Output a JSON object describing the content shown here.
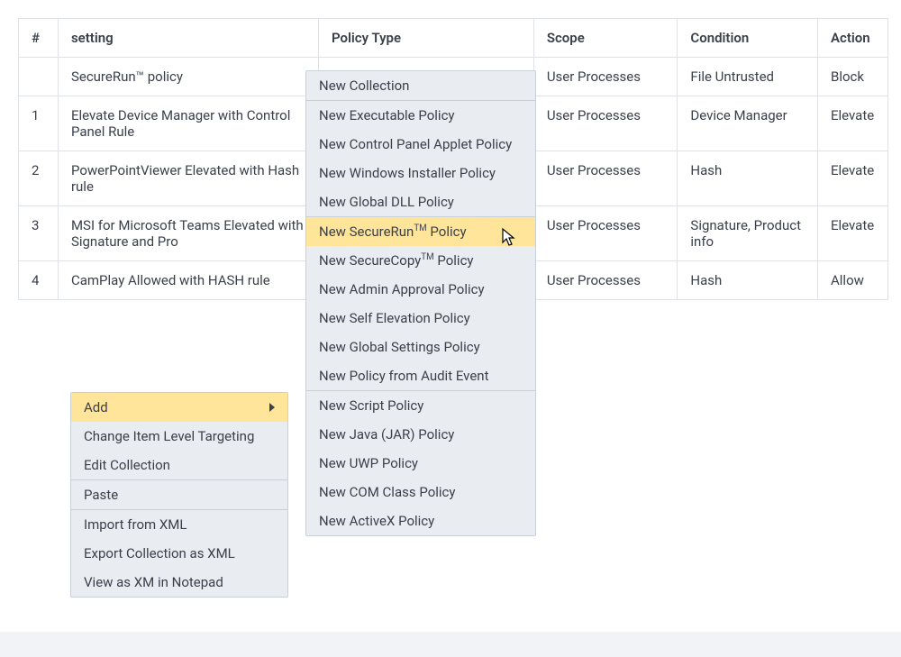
{
  "table": {
    "headers": {
      "num": "#",
      "setting": "setting",
      "policy_type": "Policy Type",
      "scope": "Scope",
      "condition": "Condition",
      "action": "Action"
    },
    "rows": [
      {
        "num": "",
        "setting": "SecureRun™ policy",
        "policy_type": "",
        "scope": "User Processes",
        "condition": "File Untrusted",
        "action": "Block"
      },
      {
        "num": "1",
        "setting": "Elevate Device Manager with Control Panel Rule",
        "policy_type": "",
        "scope": "User Processes",
        "condition": "Device Manager",
        "action": "Elevate"
      },
      {
        "num": "2",
        "setting": "PowerPointViewer Elevated with Hash rule",
        "policy_type": "",
        "scope": "User Processes",
        "condition": "Hash",
        "action": "Elevate"
      },
      {
        "num": "3",
        "setting": "MSI for Microsoft Teams Elevated with Signature and Pro",
        "policy_type": "",
        "scope": "User Processes",
        "condition": "Signature, Product info",
        "action": "Elevate"
      },
      {
        "num": "4",
        "setting": "CamPlay Allowed with HASH rule",
        "policy_type": "",
        "scope": "User Processes",
        "condition": "Hash",
        "action": "Allow"
      }
    ]
  },
  "context_menu": {
    "items": [
      {
        "label": "Add",
        "has_sub": true,
        "highlight": true
      },
      {
        "label": "Change Item Level Targeting"
      },
      {
        "label": "Edit Collection"
      },
      {
        "sep": true
      },
      {
        "label": "Paste"
      },
      {
        "sep": true
      },
      {
        "label": "Import from XML"
      },
      {
        "label": "Export Collection as XML"
      },
      {
        "label": "View as XM in Notepad"
      }
    ]
  },
  "sub_menu": {
    "items": [
      {
        "label": "New Collection"
      },
      {
        "sep": true
      },
      {
        "label": "New Executable Policy"
      },
      {
        "label": "New Control Panel Applet Policy"
      },
      {
        "label": "New Windows Installer Policy"
      },
      {
        "label": "New Global DLL Policy"
      },
      {
        "sep": true
      },
      {
        "label_pre": "New SecureRun",
        "label_sup": "TM",
        "label_post": " Policy",
        "highlight": true
      },
      {
        "label_pre": "New SecureCopy",
        "label_sup": "TM",
        "label_post": " Policy"
      },
      {
        "label": "New Admin Approval Policy"
      },
      {
        "label": "New Self Elevation Policy"
      },
      {
        "label": "New Global Settings Policy"
      },
      {
        "label": "New Policy from Audit Event"
      },
      {
        "sep": true
      },
      {
        "label": "New Script Policy"
      },
      {
        "label": "New Java (JAR) Policy"
      },
      {
        "label": "New UWP Policy"
      },
      {
        "label": "New COM Class Policy"
      },
      {
        "label": "New ActiveX Policy"
      }
    ]
  }
}
